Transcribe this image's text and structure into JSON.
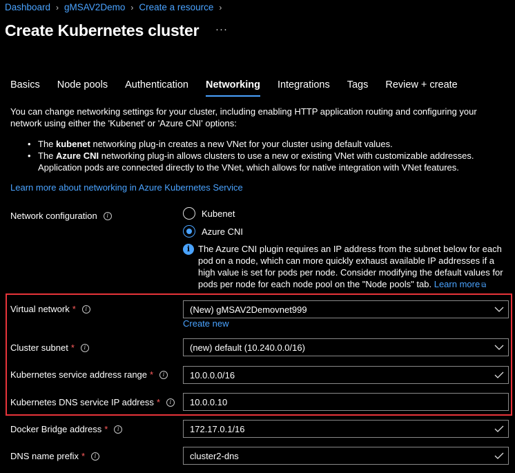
{
  "breadcrumb": [
    "Dashboard",
    "gMSAV2Demo",
    "Create a resource"
  ],
  "page_title": "Create Kubernetes cluster",
  "more_label": "···",
  "tabs": [
    {
      "label": "Basics"
    },
    {
      "label": "Node pools"
    },
    {
      "label": "Authentication"
    },
    {
      "label": "Networking",
      "active": true
    },
    {
      "label": "Integrations"
    },
    {
      "label": "Tags"
    },
    {
      "label": "Review + create"
    }
  ],
  "intro": "You can change networking settings for your cluster, including enabling HTTP application routing and configuring your network using either the 'Kubenet' or 'Azure CNI' options:",
  "bullets": [
    {
      "pre": "The ",
      "bold": "kubenet",
      "post": " networking plug-in creates a new VNet for your cluster using default values."
    },
    {
      "pre": "The ",
      "bold": "Azure CNI",
      "post": " networking plug-in allows clusters to use a new or existing VNet with customizable addresses. Application pods are connected directly to the VNet, which allows for native integration with VNet features."
    }
  ],
  "learn_more_networking": "Learn more about networking in Azure Kubernetes Service",
  "network_config": {
    "label": "Network configuration",
    "options": [
      {
        "label": "Kubenet",
        "checked": false
      },
      {
        "label": "Azure CNI",
        "checked": true
      }
    ],
    "info_text": "The Azure CNI plugin requires an IP address from the subnet below for each pod on a node, which can more quickly exhaust available IP addresses if a high value is set for pods per node. Consider modifying the default values for pods per node for each node pool on the \"Node pools\" tab.",
    "info_link": "Learn more"
  },
  "fields": {
    "virtual_network": {
      "label": "Virtual network",
      "value": "(New) gMSAV2Demovnet999",
      "create_new": "Create new"
    },
    "cluster_subnet": {
      "label": "Cluster subnet",
      "value": "(new) default (10.240.0.0/16)"
    },
    "service_range": {
      "label": "Kubernetes service address range",
      "value": "10.0.0.0/16"
    },
    "dns_service_ip": {
      "label": "Kubernetes DNS service IP address",
      "value": "10.0.0.10"
    },
    "docker_bridge": {
      "label": "Docker Bridge address",
      "value": "172.17.0.1/16"
    },
    "dns_prefix": {
      "label": "DNS name prefix",
      "value": "cluster2-dns"
    }
  },
  "required_mark": "*",
  "info_glyph": "i",
  "colors": {
    "accent": "#4aa3ff",
    "highlight_border": "#e8343a",
    "required": "#ff5c5c"
  }
}
